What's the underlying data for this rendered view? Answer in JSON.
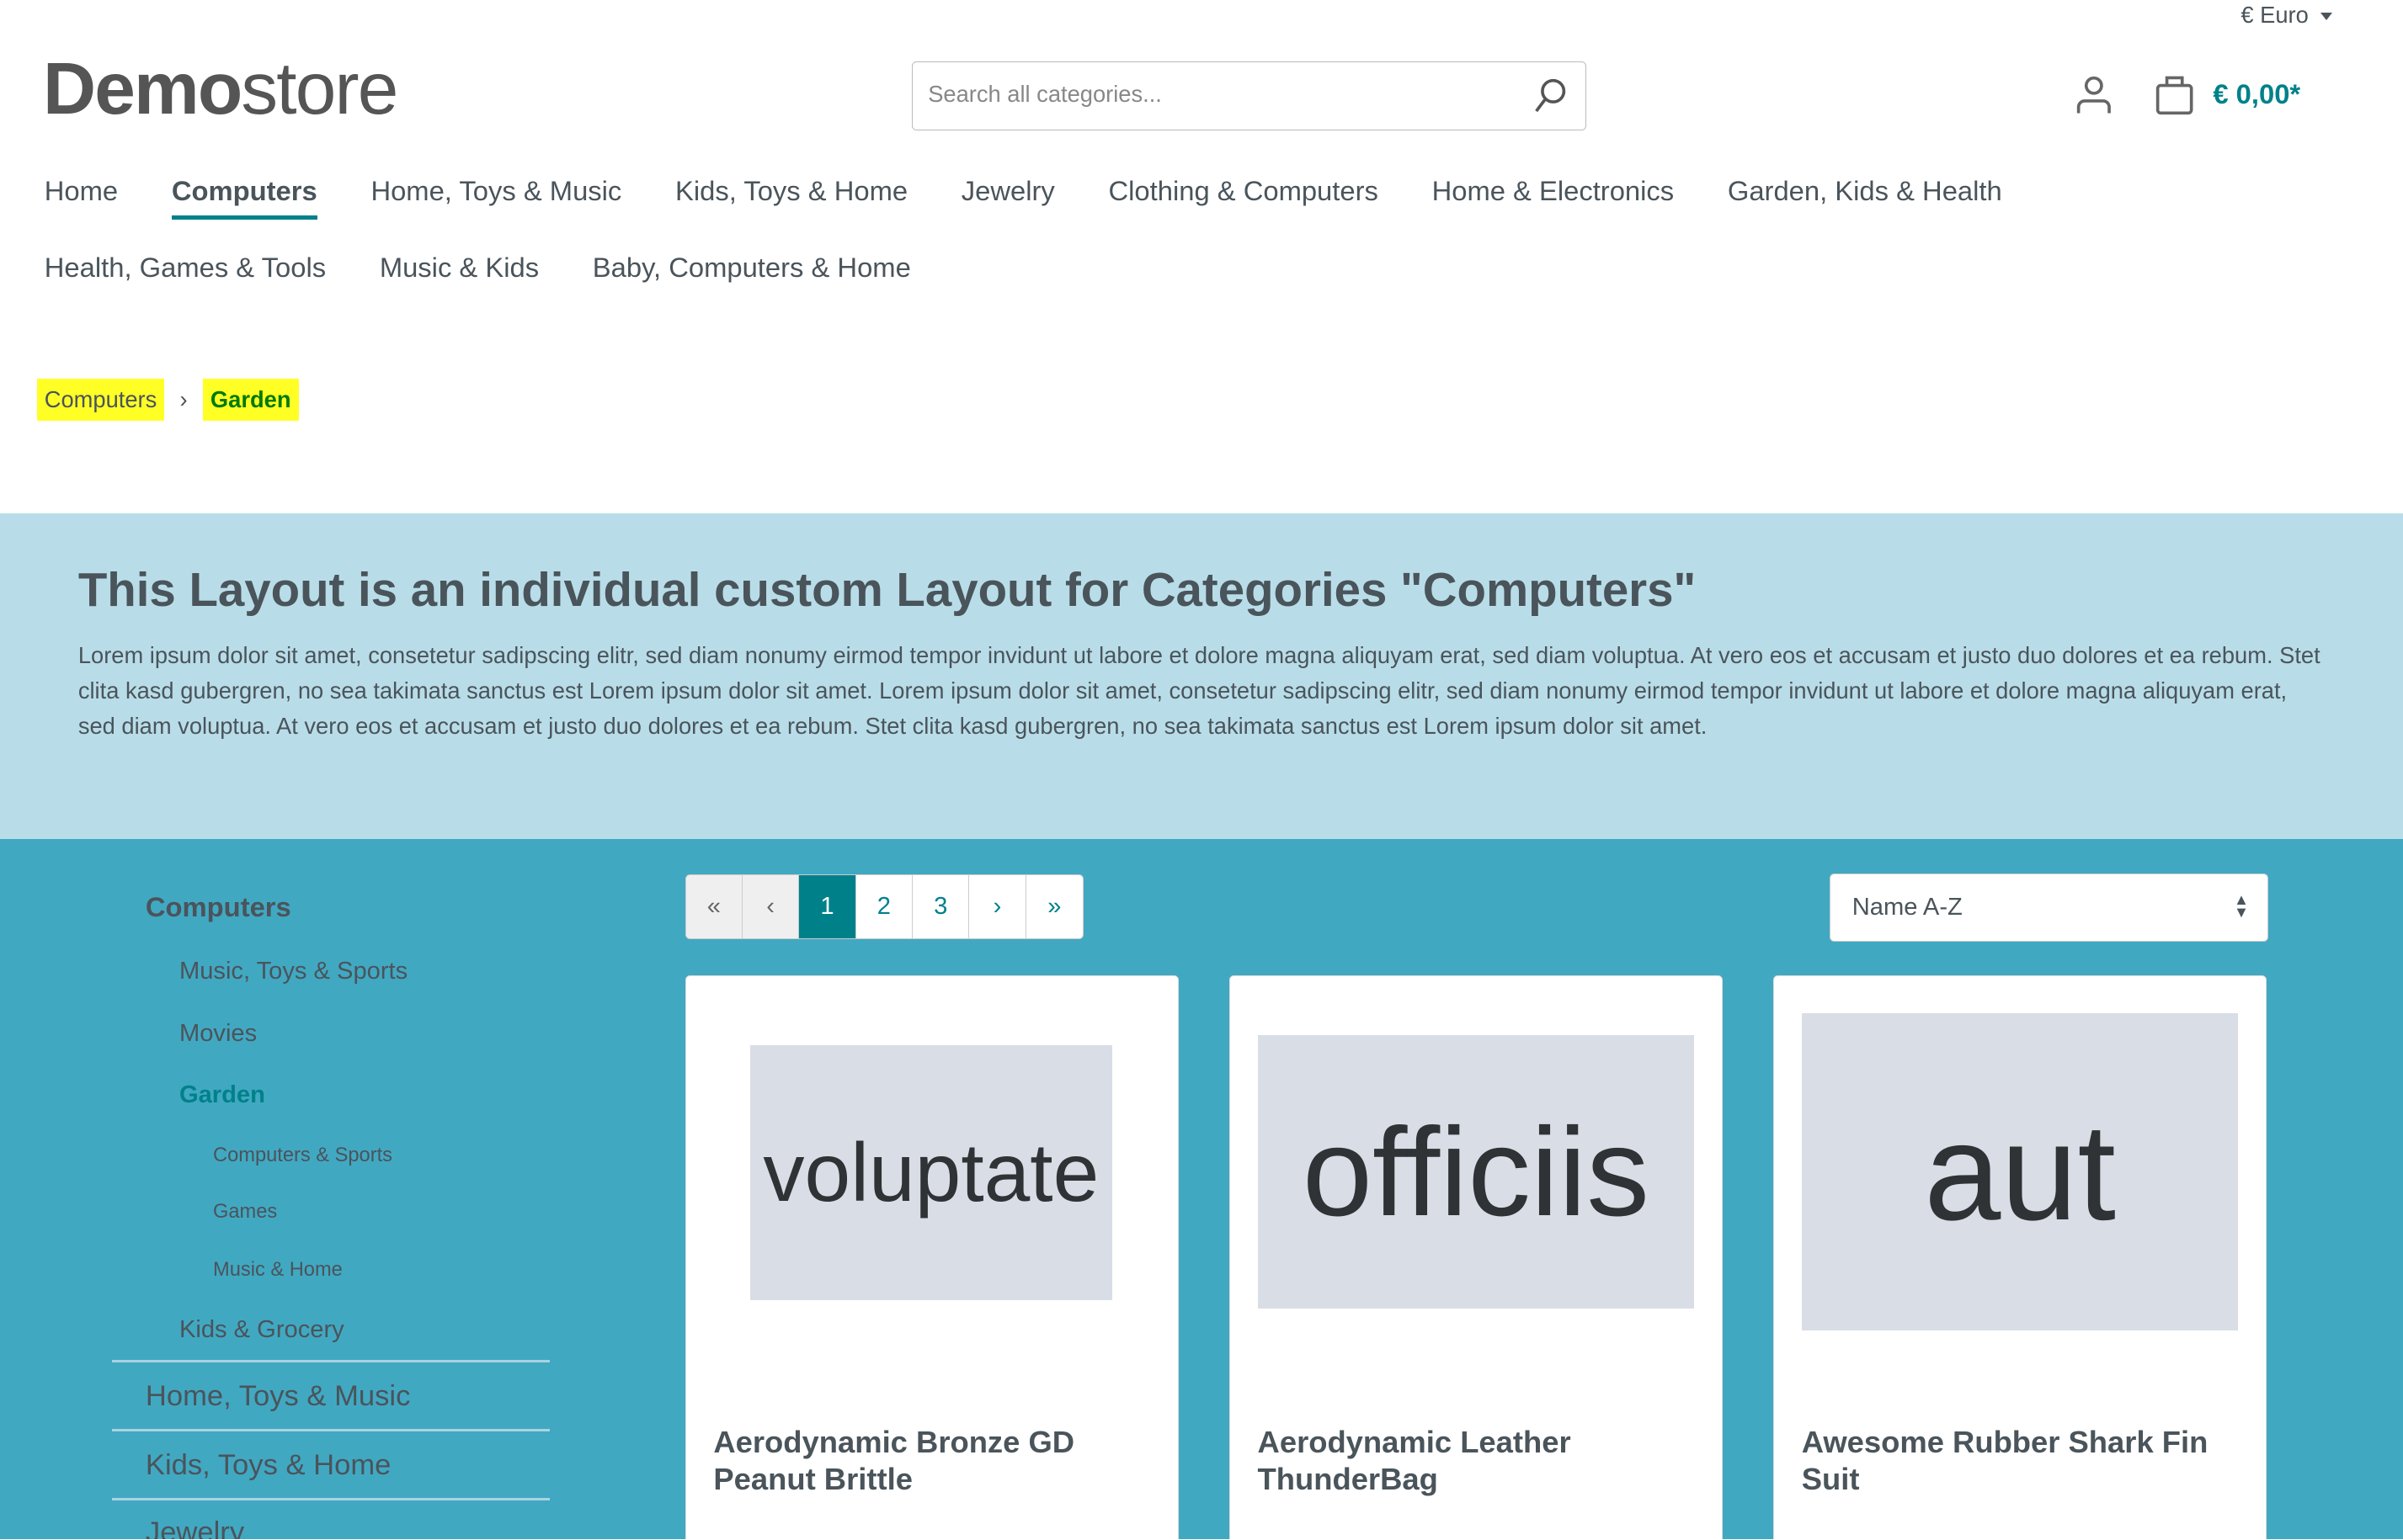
{
  "header": {
    "currency": "€ Euro",
    "logo_bold": "Demo",
    "logo_light": "store",
    "search_placeholder": "Search all categories...",
    "cart_total": "€ 0,00*"
  },
  "nav": {
    "row1": [
      "Home",
      "Computers",
      "Home, Toys & Music",
      "Kids, Toys & Home",
      "Jewelry",
      "Clothing & Computers",
      "Home & Electronics",
      "Garden, Kids & Health"
    ],
    "row2": [
      "Health, Games & Tools",
      "Music & Kids",
      "Baby, Computers & Home"
    ],
    "active": "Computers"
  },
  "breadcrumb": {
    "items": [
      "Computers",
      "Garden"
    ],
    "highlight_color": "#ffff26"
  },
  "banner": {
    "title": "This Layout is an individual custom Layout for Categories \"Computers\"",
    "text": "Lorem ipsum dolor sit amet, consetetur sadipscing elitr, sed diam nonumy eirmod tempor invidunt ut labore et dolore magna aliquyam erat, sed diam voluptua. At vero eos et accusam et justo duo dolores et ea rebum. Stet clita kasd gubergren, no sea takimata sanctus est Lorem ipsum dolor sit amet. Lorem ipsum dolor sit amet, consetetur sadipscing elitr, sed diam nonumy eirmod tempor invidunt ut labore et dolore magna aliquyam erat, sed diam voluptua. At vero eos et accusam et justo duo dolores et ea rebum. Stet clita kasd gubergren, no sea takimata sanctus est Lorem ipsum dolor sit amet."
  },
  "sidebar": {
    "root": "Computers",
    "children": [
      "Music, Toys & Sports",
      "Movies",
      "Garden"
    ],
    "grandchildren": [
      "Computers & Sports",
      "Games",
      "Music & Home"
    ],
    "after": "Kids & Grocery",
    "top": [
      "Home, Toys & Music",
      "Kids, Toys & Home",
      "Jewelry"
    ]
  },
  "pagination": {
    "first": "«",
    "prev": "‹",
    "pages": [
      "1",
      "2",
      "3"
    ],
    "current": "1",
    "next": "›",
    "last": "»"
  },
  "sort": {
    "selected": "Name A-Z"
  },
  "products": [
    {
      "image_text": "voluptate",
      "name": "Aerodynamic Bronze GD Peanut Brittle"
    },
    {
      "image_text": "officiis",
      "name": "Aerodynamic Leather ThunderBag"
    },
    {
      "image_text": "aut",
      "name": "Awesome Rubber Shark Fin Suit"
    }
  ],
  "colors": {
    "accent": "#00818a",
    "main_bg": "#41a8c2",
    "banner_bg": "#b9dde8"
  }
}
